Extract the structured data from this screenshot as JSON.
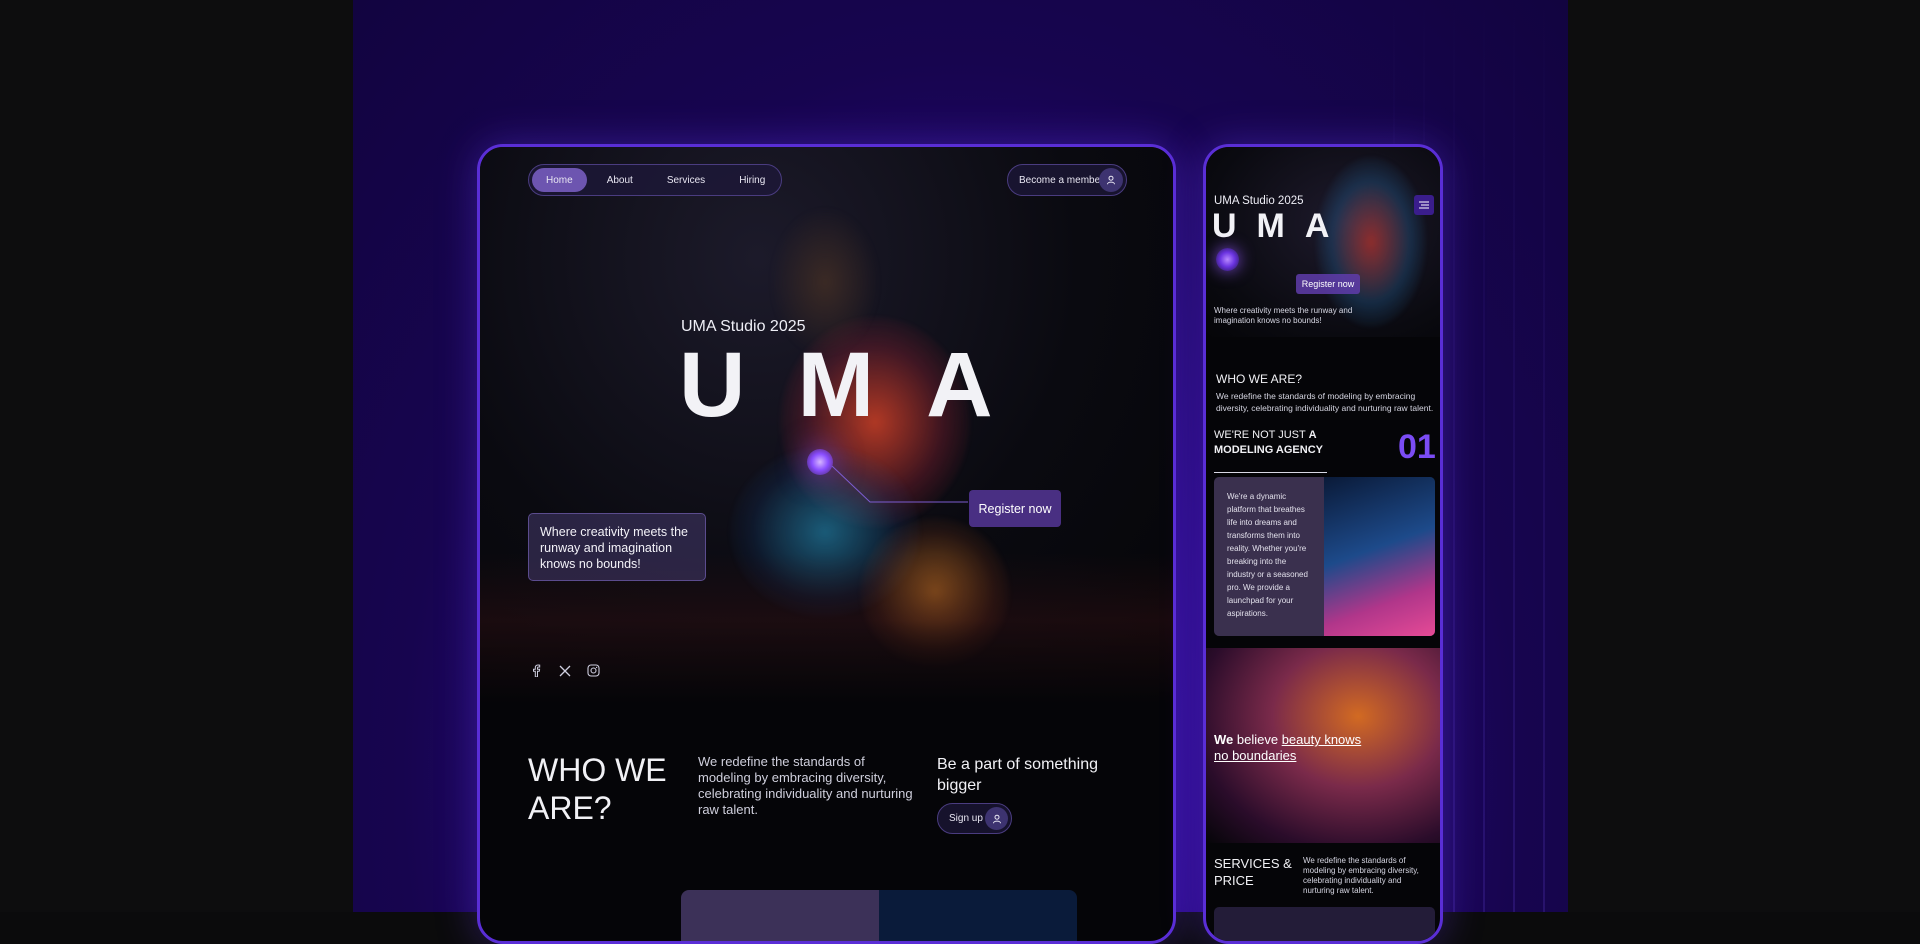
{
  "desktop": {
    "nav": {
      "items": [
        {
          "label": "Home",
          "active": true
        },
        {
          "label": "About",
          "active": false
        },
        {
          "label": "Services",
          "active": false
        },
        {
          "label": "Hiring",
          "active": false
        }
      ],
      "member_label": "Become a member"
    },
    "hero": {
      "studio": "UMA Studio 2025",
      "title": "UMA",
      "tagline": "Where creativity meets the runway and imagination knows no bounds!",
      "register_label": "Register now"
    },
    "socials": [
      "facebook-icon",
      "x-icon",
      "instagram-icon"
    ],
    "who": {
      "heading": "WHO WE ARE?",
      "body": "We redefine the standards of modeling by embracing diversity, celebrating individuality and nurturing raw talent.",
      "cta_heading": "Be a part of something bigger",
      "signup_label": "Sign up"
    }
  },
  "mobile": {
    "studio": "UMA Studio 2025",
    "title": "UMA",
    "register_label": "Register now",
    "tagline": "Where creativity meets the runway and imagination knows no bounds!",
    "who_heading": "WHO WE ARE?",
    "who_body": "We redefine the standards of modeling by embracing diversity, celebrating individuality and nurturing raw talent.",
    "notjust_prefix": "WE'RE NOT JUST ",
    "notjust_bold": "A MODELING AGENCY",
    "number": "01",
    "card_text": "We're a dynamic platform that breathes life into dreams and transforms them into reality. Whether you're breaking into the industry or a seasoned pro. We provide a launchpad for your aspirations.",
    "believe_bold": "We",
    "believe_mid": " believe ",
    "believe_link": "beauty knows no boundaries",
    "services_heading": "SERVICES & PRICE",
    "services_body": "We redefine the standards of modeling by embracing diversity, celebrating individuality and nurturing raw talent."
  },
  "colors": {
    "accent": "#5a2ed6",
    "number": "#7b4cf5",
    "background": "#17054f"
  }
}
